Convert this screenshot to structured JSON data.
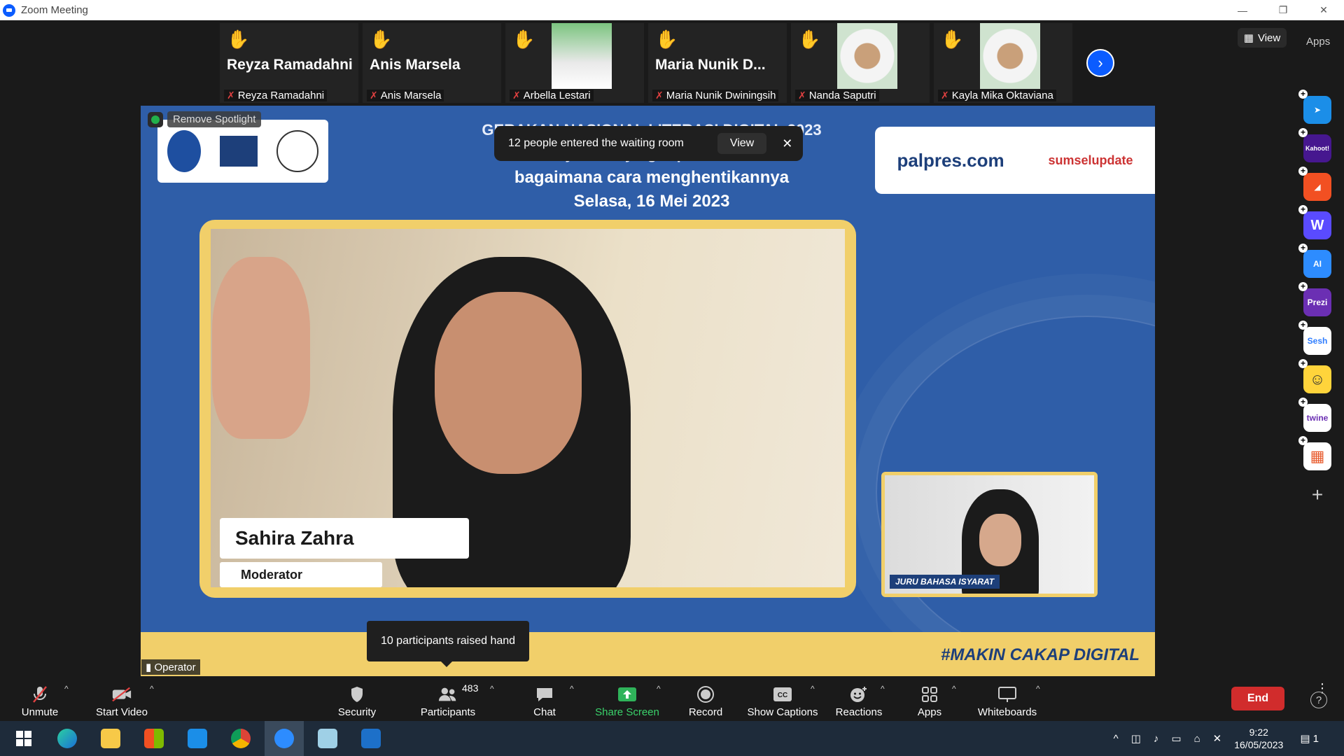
{
  "window": {
    "title": "Zoom Meeting",
    "minimize": "—",
    "restore": "❐",
    "close": "✕"
  },
  "strip": {
    "tiles": [
      {
        "big": "Reyza Ramadahni",
        "label": "Reyza Ramadahni"
      },
      {
        "big": "Anis Marsela",
        "label": "Anis Marsela"
      },
      {
        "big": "",
        "label": "Arbella Lestari"
      },
      {
        "big": "Maria Nunik D...",
        "label": "Maria Nunik Dwiningsih"
      },
      {
        "big": "",
        "label": "Nanda Saputri"
      },
      {
        "big": "",
        "label": "Kayla Mika Oktaviana"
      }
    ],
    "next_icon": "›",
    "view_label": "View",
    "apps_label": "Apps"
  },
  "share": {
    "headline1": "GERAKAN NASIONAL LITERASI DIGITAL 2023",
    "headline2": "Cyberbullying: Apa itu dan",
    "headline3": "bagaimana cara menghentikannya",
    "headline4": "Selasa, 16 Mei 2023",
    "logo_kominfo": "KOMINFO",
    "logo_makin": "MAKIN CAKAP DIGITAL",
    "logo_siber": "siberkreasi",
    "logo_palpres": "palpres.com",
    "logo_sumsel": "sumselupdate",
    "speaker_name": "Sahira Zahra",
    "speaker_role": "Moderator",
    "interpreter_label": "JURU BAHASA ISYARAT",
    "hashtag": "#MAKIN CAKAP DIGITAL",
    "remove_spotlight": "Remove Spotlight",
    "operator": "Operator"
  },
  "waiting": {
    "message": "12 people entered the waiting room",
    "view": "View",
    "close": "✕"
  },
  "raised": {
    "message": "10 participants raised hand"
  },
  "apps": [
    {
      "name": "Fireflies",
      "color": "#1b8ee8",
      "glyph": "➤"
    },
    {
      "name": "Kahoot!",
      "color": "#46178f",
      "glyph": "Kahoot!"
    },
    {
      "name": "Cell",
      "color": "#f25022",
      "glyph": "◢"
    },
    {
      "name": "Wooclap",
      "color": "#5a4bff",
      "glyph": "W"
    },
    {
      "name": "AI Companion",
      "color": "#2d8cff",
      "glyph": "AI"
    },
    {
      "name": "Prezi",
      "color": "#6b2fb3",
      "glyph": "Prezi"
    },
    {
      "name": "Sesh",
      "color": "#ffffff",
      "glyph": "Sesh"
    },
    {
      "name": "Emoji",
      "color": "#ffd43b",
      "glyph": "☺"
    },
    {
      "name": "twine",
      "color": "#ffffff",
      "glyph": "twine"
    },
    {
      "name": "Blocks",
      "color": "#ffffff",
      "glyph": "▦"
    }
  ],
  "add_app": "+",
  "toolbar": {
    "unmute": "Unmute",
    "start_video": "Start Video",
    "security": "Security",
    "participants": "Participants",
    "participants_count": "483",
    "chat": "Chat",
    "share_screen": "Share Screen",
    "record": "Record",
    "show_captions": "Show Captions",
    "reactions": "Reactions",
    "apps": "Apps",
    "whiteboards": "Whiteboards",
    "end": "End",
    "more": "⋮",
    "help": "?"
  },
  "taskbar": {
    "time": "9:22",
    "date": "16/05/2023",
    "notif": "1"
  }
}
